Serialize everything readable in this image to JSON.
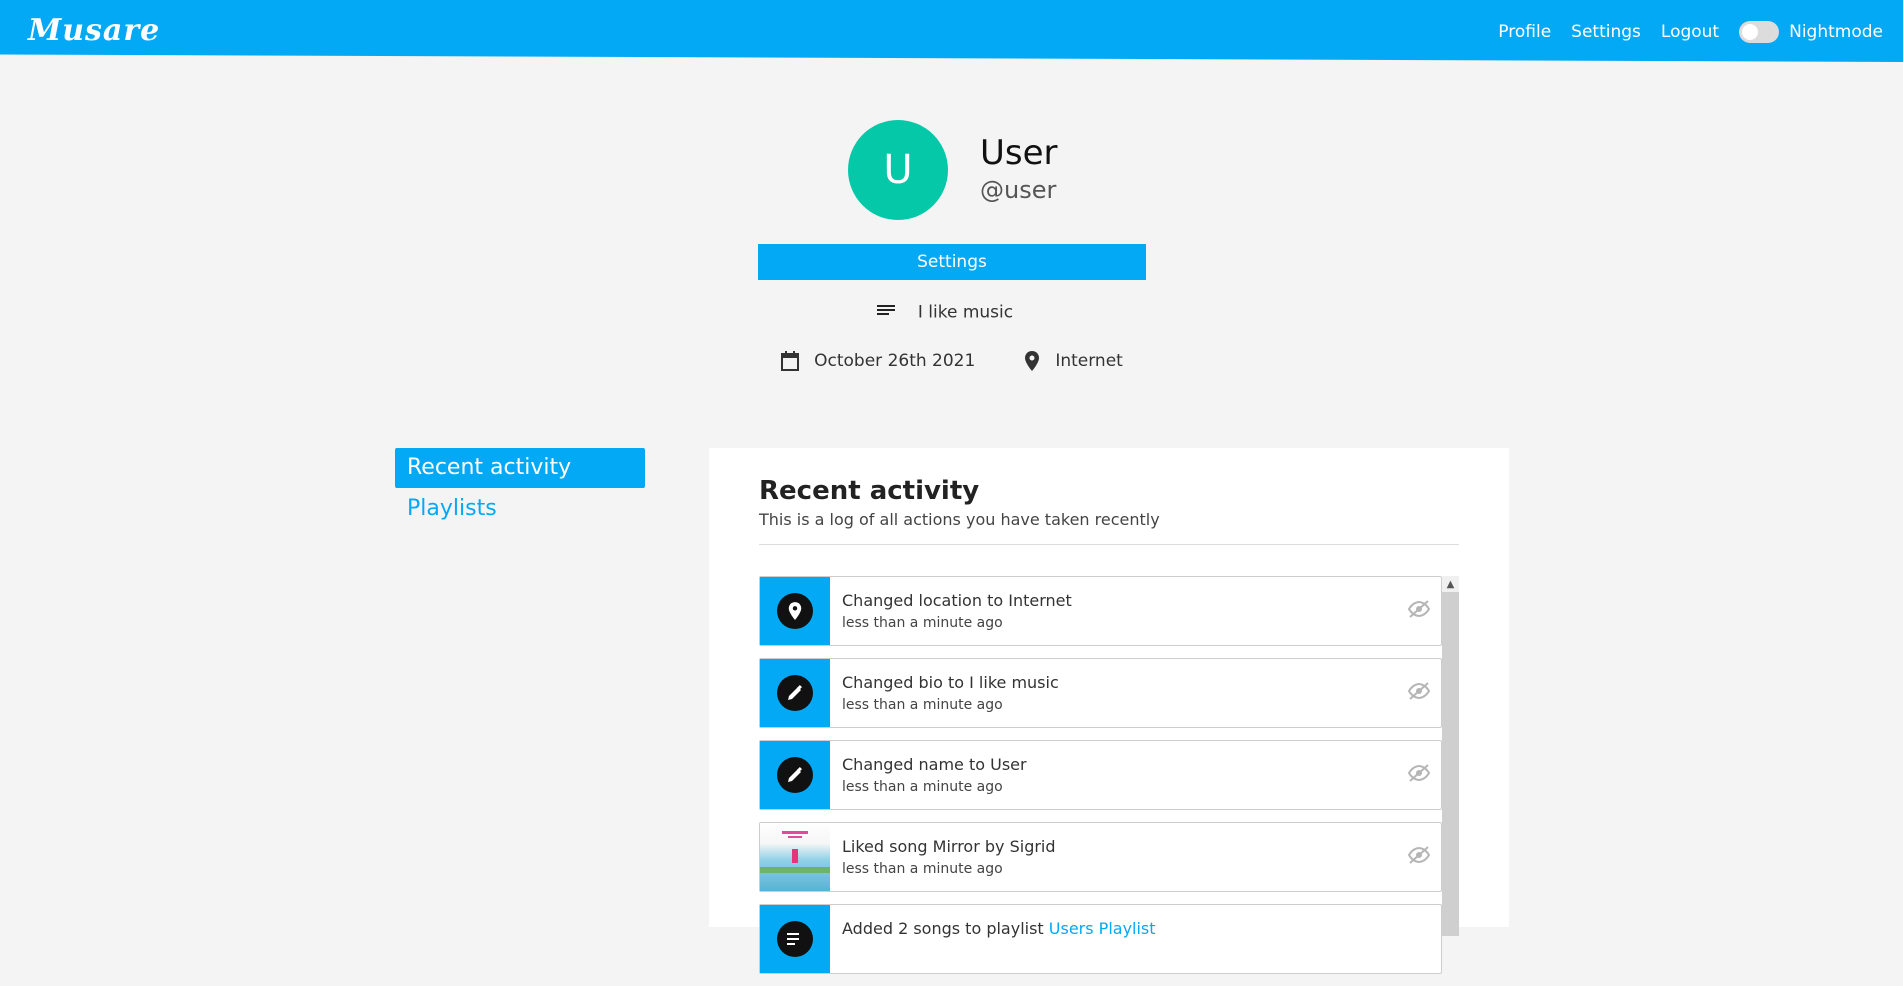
{
  "header": {
    "logo": "Musare",
    "nav": {
      "profile": "Profile",
      "settings": "Settings",
      "logout": "Logout",
      "nightmode": "Nightmode"
    },
    "nightmode_on": false,
    "accent": "#03a9f4"
  },
  "profile": {
    "avatar_letter": "U",
    "avatar_color": "#04c8a8",
    "name": "User",
    "username": "@user",
    "settings_label": "Settings",
    "bio": "I like music",
    "joined": "October 26th 2021",
    "location": "Internet"
  },
  "sidebar": {
    "items": [
      {
        "label": "Recent activity",
        "active": true
      },
      {
        "label": "Playlists",
        "active": false
      }
    ]
  },
  "panel": {
    "title": "Recent activity",
    "subtitle": "This is a log of all actions you have taken recently",
    "activities": [
      {
        "icon": "location-icon",
        "prefix": "Changed location to Internet",
        "link": "",
        "time": "less than a minute ago"
      },
      {
        "icon": "pencil-icon",
        "prefix": "Changed bio to I like music",
        "link": "",
        "time": "less than a minute ago"
      },
      {
        "icon": "pencil-icon",
        "prefix": "Changed name to User",
        "link": "",
        "time": "less than a minute ago"
      },
      {
        "icon": "song-thumbnail",
        "prefix": "Liked song Mirror by Sigrid",
        "link": "",
        "time": "less than a minute ago"
      },
      {
        "icon": "playlist-icon",
        "prefix": "Added 2 songs to playlist ",
        "link": "Users Playlist",
        "time": ""
      }
    ]
  }
}
